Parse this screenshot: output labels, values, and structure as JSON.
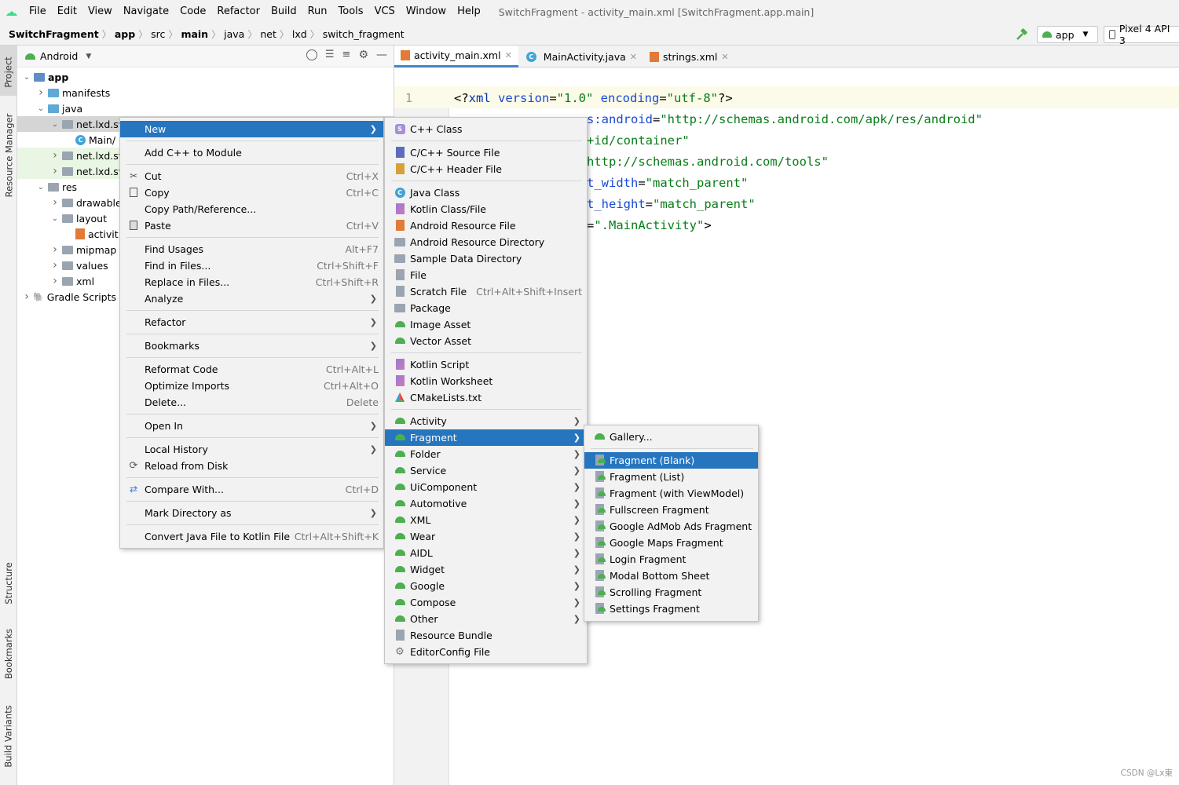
{
  "menubar": {
    "items": [
      "File",
      "Edit",
      "View",
      "Navigate",
      "Code",
      "Refactor",
      "Build",
      "Run",
      "Tools",
      "VCS",
      "Window",
      "Help"
    ],
    "title": "SwitchFragment - activity_main.xml [SwitchFragment.app.main]"
  },
  "breadcrumb": [
    "SwitchFragment",
    "app",
    "src",
    "main",
    "java",
    "net",
    "lxd",
    "switch_fragment"
  ],
  "toolbar": {
    "run_config": "app",
    "device": "Pixel 4 API 3"
  },
  "side_tabs": {
    "project": "Project",
    "resource_manager": "Resource Manager",
    "structure": "Structure",
    "bookmarks": "Bookmarks",
    "build_variants": "Build Variants"
  },
  "project": {
    "view": "Android",
    "tree": [
      {
        "label": "app",
        "indent": 0,
        "arrow": "v",
        "icon": "app"
      },
      {
        "label": "manifests",
        "indent": 1,
        "arrow": ">",
        "icon": "blue"
      },
      {
        "label": "java",
        "indent": 1,
        "arrow": "v",
        "icon": "blue"
      },
      {
        "label": "net.lxd.sv",
        "indent": 2,
        "arrow": "v",
        "icon": "pkg"
      },
      {
        "label": "Main/",
        "indent": 3,
        "arrow": "",
        "icon": "class"
      },
      {
        "label": "net.lxd.sv",
        "indent": 2,
        "arrow": ">",
        "icon": "pkg"
      },
      {
        "label": "net.lxd.sv",
        "indent": 2,
        "arrow": ">",
        "icon": "pkg"
      },
      {
        "label": "res",
        "indent": 1,
        "arrow": "v",
        "icon": "res"
      },
      {
        "label": "drawable",
        "indent": 2,
        "arrow": ">",
        "icon": "pkg"
      },
      {
        "label": "layout",
        "indent": 2,
        "arrow": "v",
        "icon": "pkg"
      },
      {
        "label": "activit",
        "indent": 3,
        "arrow": "",
        "icon": "xml"
      },
      {
        "label": "mipmap",
        "indent": 2,
        "arrow": ">",
        "icon": "pkg"
      },
      {
        "label": "values",
        "indent": 2,
        "arrow": ">",
        "icon": "pkg"
      },
      {
        "label": "xml",
        "indent": 2,
        "arrow": ">",
        "icon": "pkg"
      },
      {
        "label": "Gradle Scripts",
        "indent": 0,
        "arrow": ">",
        "icon": "gradle"
      }
    ]
  },
  "tabs": [
    {
      "label": "activity_main.xml",
      "icon": "xml"
    },
    {
      "label": "MainActivity.java",
      "icon": "class"
    },
    {
      "label": "strings.xml",
      "icon": "xml"
    }
  ],
  "editor": {
    "line_number": "1",
    "lines": [
      [
        {
          "t": "<?",
          "c": ""
        },
        {
          "t": "xml ",
          "c": "kw"
        },
        {
          "t": "version",
          "c": "at"
        },
        {
          "t": "=",
          "c": ""
        },
        {
          "t": "\"1.0\" ",
          "c": "st"
        },
        {
          "t": "encoding",
          "c": "at"
        },
        {
          "t": "=",
          "c": ""
        },
        {
          "t": "\"utf-8\"",
          "c": "st"
        },
        {
          "t": "?>",
          "c": ""
        }
      ],
      [
        {
          "t": "s:android",
          "c": "at"
        },
        {
          "t": "=",
          "c": ""
        },
        {
          "t": "\"http://schemas.android.com/apk/res/android\"",
          "c": "st"
        }
      ],
      [
        {
          "t": "+id/container\"",
          "c": "st"
        }
      ],
      [
        {
          "t": "http://schemas.android.com/tools\"",
          "c": "st"
        }
      ],
      [
        {
          "t": "t_width",
          "c": "at"
        },
        {
          "t": "=",
          "c": ""
        },
        {
          "t": "\"match_parent\"",
          "c": "st"
        }
      ],
      [
        {
          "t": "t_height",
          "c": "at"
        },
        {
          "t": "=",
          "c": ""
        },
        {
          "t": "\"match_parent\"",
          "c": "st"
        }
      ],
      [
        {
          "t": "=",
          "c": ""
        },
        {
          "t": "\".MainActivity\"",
          "c": "st"
        },
        {
          "t": ">",
          "c": ""
        }
      ]
    ]
  },
  "context_menu": [
    {
      "label": "New",
      "sub": true,
      "sel": true
    },
    {
      "sep": true
    },
    {
      "label": "Add C++ to Module"
    },
    {
      "sep": true
    },
    {
      "label": "Cut",
      "sc": "Ctrl+X",
      "icon": "cut"
    },
    {
      "label": "Copy",
      "sc": "Ctrl+C",
      "icon": "copy"
    },
    {
      "label": "Copy Path/Reference..."
    },
    {
      "label": "Paste",
      "sc": "Ctrl+V",
      "icon": "paste"
    },
    {
      "sep": true
    },
    {
      "label": "Find Usages",
      "sc": "Alt+F7"
    },
    {
      "label": "Find in Files...",
      "sc": "Ctrl+Shift+F"
    },
    {
      "label": "Replace in Files...",
      "sc": "Ctrl+Shift+R"
    },
    {
      "label": "Analyze",
      "sub": true
    },
    {
      "sep": true
    },
    {
      "label": "Refactor",
      "sub": true
    },
    {
      "sep": true
    },
    {
      "label": "Bookmarks",
      "sub": true
    },
    {
      "sep": true
    },
    {
      "label": "Reformat Code",
      "sc": "Ctrl+Alt+L"
    },
    {
      "label": "Optimize Imports",
      "sc": "Ctrl+Alt+O"
    },
    {
      "label": "Delete...",
      "sc": "Delete"
    },
    {
      "sep": true
    },
    {
      "label": "Open In",
      "sub": true
    },
    {
      "sep": true
    },
    {
      "label": "Local History",
      "sub": true
    },
    {
      "label": "Reload from Disk",
      "icon": "reload"
    },
    {
      "sep": true
    },
    {
      "label": "Compare With...",
      "sc": "Ctrl+D",
      "icon": "compare"
    },
    {
      "sep": true
    },
    {
      "label": "Mark Directory as",
      "sub": true
    },
    {
      "sep": true
    },
    {
      "label": "Convert Java File to Kotlin File",
      "sc": "Ctrl+Alt+Shift+K"
    }
  ],
  "new_menu": [
    {
      "label": "C++ Class",
      "icon": "s"
    },
    {
      "sep": true
    },
    {
      "label": "C/C++ Source File",
      "icon": "cpp"
    },
    {
      "label": "C/C++ Header File",
      "icon": "h"
    },
    {
      "sep": true
    },
    {
      "label": "Java Class",
      "icon": "c"
    },
    {
      "label": "Kotlin Class/File",
      "icon": "k"
    },
    {
      "label": "Android Resource File",
      "icon": "x"
    },
    {
      "label": "Android Resource Directory",
      "icon": "folder"
    },
    {
      "label": "Sample Data Directory",
      "icon": "folder"
    },
    {
      "label": "File",
      "icon": "g"
    },
    {
      "label": "Scratch File",
      "sc": "Ctrl+Alt+Shift+Insert",
      "icon": "g"
    },
    {
      "label": "Package",
      "icon": "pkg"
    },
    {
      "label": "Image Asset",
      "icon": "android"
    },
    {
      "label": "Vector Asset",
      "icon": "android"
    },
    {
      "sep": true
    },
    {
      "label": "Kotlin Script",
      "icon": "k"
    },
    {
      "label": "Kotlin Worksheet",
      "icon": "k"
    },
    {
      "label": "CMakeLists.txt",
      "icon": "cmake"
    },
    {
      "sep": true
    },
    {
      "label": "Activity",
      "sub": true,
      "icon": "android"
    },
    {
      "label": "Fragment",
      "sub": true,
      "sel": true,
      "icon": "android"
    },
    {
      "label": "Folder",
      "sub": true,
      "icon": "android"
    },
    {
      "label": "Service",
      "sub": true,
      "icon": "android"
    },
    {
      "label": "UiComponent",
      "sub": true,
      "icon": "android"
    },
    {
      "label": "Automotive",
      "sub": true,
      "icon": "android"
    },
    {
      "label": "XML",
      "sub": true,
      "icon": "android"
    },
    {
      "label": "Wear",
      "sub": true,
      "icon": "android"
    },
    {
      "label": "AIDL",
      "sub": true,
      "icon": "android"
    },
    {
      "label": "Widget",
      "sub": true,
      "icon": "android"
    },
    {
      "label": "Google",
      "sub": true,
      "icon": "android"
    },
    {
      "label": "Compose",
      "sub": true,
      "icon": "android"
    },
    {
      "label": "Other",
      "sub": true,
      "icon": "android"
    },
    {
      "label": "Resource Bundle",
      "icon": "g"
    },
    {
      "label": "EditorConfig File",
      "icon": "gear"
    }
  ],
  "fragment_menu": [
    {
      "label": "Gallery...",
      "icon": "android"
    },
    {
      "sep": true
    },
    {
      "label": "Fragment (Blank)",
      "sel": true,
      "icon": "frag"
    },
    {
      "label": "Fragment (List)",
      "icon": "frag"
    },
    {
      "label": "Fragment (with ViewModel)",
      "icon": "frag"
    },
    {
      "label": "Fullscreen Fragment",
      "icon": "frag"
    },
    {
      "label": "Google AdMob Ads Fragment",
      "icon": "frag"
    },
    {
      "label": "Google Maps Fragment",
      "icon": "frag"
    },
    {
      "label": "Login Fragment",
      "icon": "frag"
    },
    {
      "label": "Modal Bottom Sheet",
      "icon": "frag"
    },
    {
      "label": "Scrolling Fragment",
      "icon": "frag"
    },
    {
      "label": "Settings Fragment",
      "icon": "frag"
    }
  ],
  "watermark": "CSDN @Lx東",
  "colors": {
    "selection": "#2675bf",
    "android_green": "#4caf50",
    "tab_underline": "#4083c9"
  }
}
